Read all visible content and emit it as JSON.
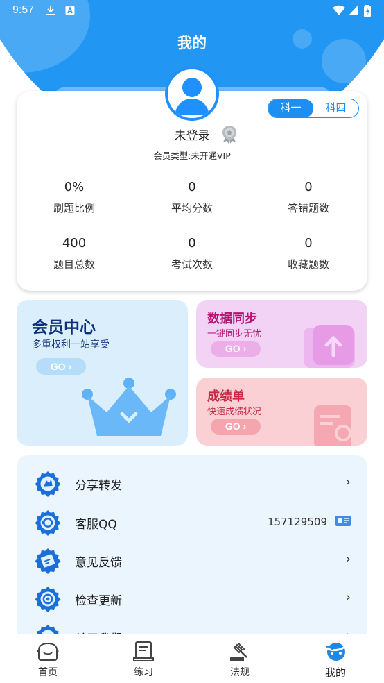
{
  "status_bar": {
    "time": "9:57"
  },
  "header": {
    "title": "我的"
  },
  "profile": {
    "subject_tabs": [
      "科一",
      "科四"
    ],
    "selected_tab": "科一",
    "username": "未登录",
    "membership": "会员类型:未开通VIP",
    "stats": [
      {
        "value": "0%",
        "label": "刷题比例"
      },
      {
        "value": "0",
        "label": "平均分数"
      },
      {
        "value": "0",
        "label": "答错题数"
      },
      {
        "value": "400",
        "label": "题目总数"
      },
      {
        "value": "0",
        "label": "考试次数"
      },
      {
        "value": "0",
        "label": "收藏题数"
      }
    ]
  },
  "promos": {
    "member": {
      "title": "会员中心",
      "subtitle": "多重权利一站享受",
      "go": "GO"
    },
    "sync": {
      "title": "数据同步",
      "subtitle": "一键同步无忧",
      "go": "GO"
    },
    "report": {
      "title": "成绩单",
      "subtitle": "快速成绩状况",
      "go": "GO"
    }
  },
  "menu": {
    "items": [
      {
        "label": "分享转发",
        "icon": "share-icon"
      },
      {
        "label": "客服QQ",
        "icon": "customer-service-icon",
        "value": "157129509"
      },
      {
        "label": "意见反馈",
        "icon": "feedback-icon"
      },
      {
        "label": "检查更新",
        "icon": "update-icon"
      },
      {
        "label": "关于我们",
        "icon": "about-icon"
      }
    ],
    "chevron": "›"
  },
  "bottom_nav": {
    "items": [
      {
        "label": "首页",
        "icon": "home-icon"
      },
      {
        "label": "练习",
        "icon": "practice-icon"
      },
      {
        "label": "法规",
        "icon": "law-icon"
      },
      {
        "label": "我的",
        "icon": "profile-icon"
      }
    ],
    "active": "我的"
  },
  "colors": {
    "primary": "#2196f3",
    "member_card": "#dbeefc",
    "sync_card": "#f2d3f6",
    "report_card": "#fbd0d5",
    "menu_bg": "#eaf5fd"
  }
}
